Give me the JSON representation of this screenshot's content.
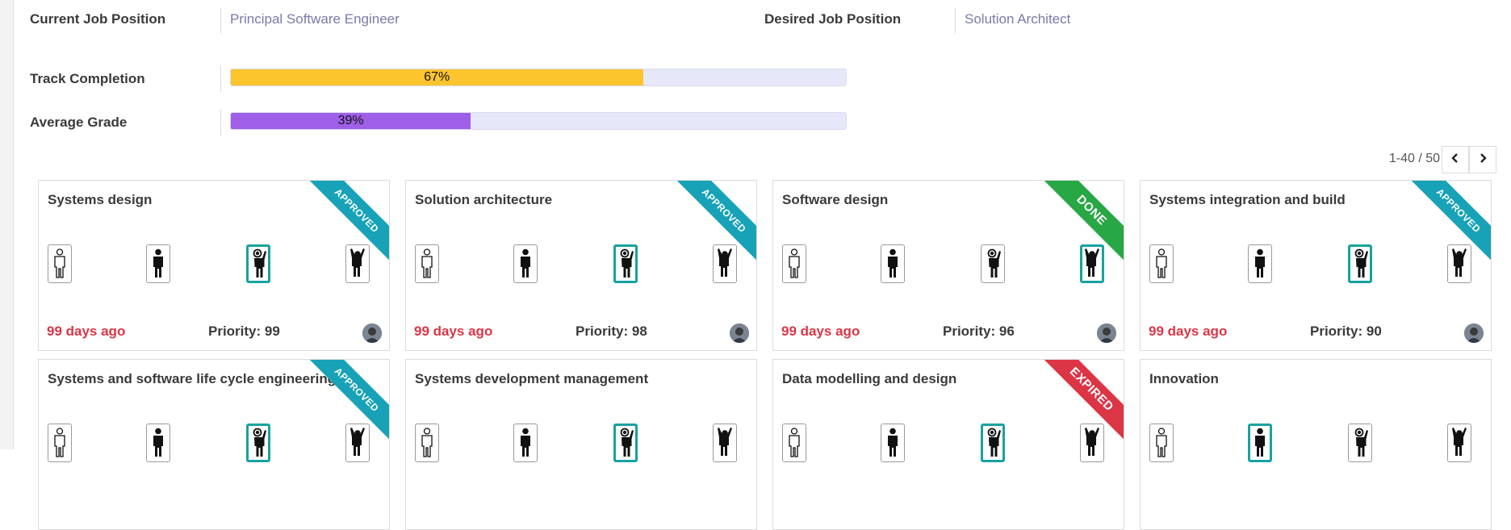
{
  "header": {
    "current_job_label": "Current Job Position",
    "current_job_value": "Principal Software Engineer",
    "desired_job_label": "Desired Job Position",
    "desired_job_value": "Solution Architect",
    "track_completion_label": "Track Completion",
    "track_completion_value": 0.67,
    "track_completion_text": "67%",
    "average_grade_label": "Average Grade",
    "average_grade_value": 0.39,
    "average_grade_text": "39%"
  },
  "colors": {
    "track_completion": "#fcc42d",
    "average_grade": "#9f5fe8",
    "active_level_border": "#17a2a0",
    "date_text": "#dc3545",
    "ribbon_approved": "#17a2b8",
    "ribbon_done": "#28a745",
    "ribbon_expired": "#dc3545"
  },
  "pager": {
    "range_text": "1-40 / 50",
    "prev_icon": "chevron-left-icon",
    "next_icon": "chevron-right-icon"
  },
  "level_icons": [
    "person-outline-icon",
    "person-standing-icon",
    "person-hand-raised-icon",
    "person-arms-up-icon"
  ],
  "cards": [
    {
      "title": "Systems design",
      "ribbon": "APPROVED",
      "active_level": 3,
      "date": "99 days ago",
      "priority": "Priority: 99"
    },
    {
      "title": "Solution architecture",
      "ribbon": "APPROVED",
      "active_level": 3,
      "date": "99 days ago",
      "priority": "Priority: 98"
    },
    {
      "title": "Software design",
      "ribbon": "DONE",
      "active_level": 4,
      "date": "99 days ago",
      "priority": "Priority: 96"
    },
    {
      "title": "Systems integration and build",
      "ribbon": "APPROVED",
      "active_level": 3,
      "date": "99 days ago",
      "priority": "Priority: 90"
    },
    {
      "title": "Systems and software life cycle engineering",
      "ribbon": "APPROVED",
      "active_level": 3,
      "date": "",
      "priority": ""
    },
    {
      "title": "Systems development management",
      "ribbon": "",
      "active_level": 3,
      "date": "",
      "priority": ""
    },
    {
      "title": "Data modelling and design",
      "ribbon": "EXPIRED",
      "active_level": 3,
      "date": "",
      "priority": ""
    },
    {
      "title": "Innovation",
      "ribbon": "",
      "active_level": 2,
      "date": "",
      "priority": ""
    }
  ]
}
